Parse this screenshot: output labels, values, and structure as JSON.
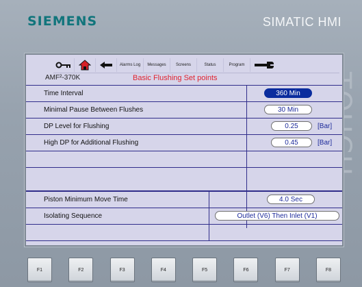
{
  "header": {
    "brand": "SIEMENS",
    "product": "SIMATIC HMI",
    "bezel_label": "TOUCH"
  },
  "toolbar": {
    "items": [
      {
        "type": "icon",
        "icon": "key-icon"
      },
      {
        "type": "icon",
        "icon": "home-icon"
      },
      {
        "type": "icon",
        "icon": "back-arrow-icon"
      },
      {
        "type": "text",
        "label": "Alarms Log"
      },
      {
        "type": "text",
        "label": "Messages"
      },
      {
        "type": "text",
        "label": "Screens"
      },
      {
        "type": "text",
        "label": "Status"
      },
      {
        "type": "text",
        "label": "Program"
      },
      {
        "type": "icon",
        "icon": "wrench-icon"
      }
    ]
  },
  "screen": {
    "model": "AMF²-370K",
    "title": "Basic Flushing Set points"
  },
  "setpoints": [
    {
      "label": "Time Interval",
      "value": "360 Min",
      "unit": "",
      "active": true
    },
    {
      "label": "Minimal Pause Between Flushes",
      "value": "30 Min",
      "unit": "",
      "active": false
    },
    {
      "label": "DP Level for Flushing",
      "value": "0.25",
      "unit": "[Bar]",
      "active": false
    },
    {
      "label": "High DP for Additional Flushing",
      "value": "0.45",
      "unit": "[Bar]",
      "active": false
    }
  ],
  "piston": [
    {
      "label": "Piston Minimum Move Time",
      "value": "4.0 Sec"
    },
    {
      "label": "Isolating Sequence",
      "value": "Outlet (V6) Then Inlet (V1)"
    }
  ],
  "function_keys": [
    "F1",
    "F2",
    "F3",
    "F4",
    "F5",
    "F6",
    "F7",
    "F8"
  ],
  "colors": {
    "accent": "#0a2c9e",
    "title_red": "#e0232f",
    "brand_teal": "#11757c",
    "screen_bg": "#d6d5ea"
  }
}
